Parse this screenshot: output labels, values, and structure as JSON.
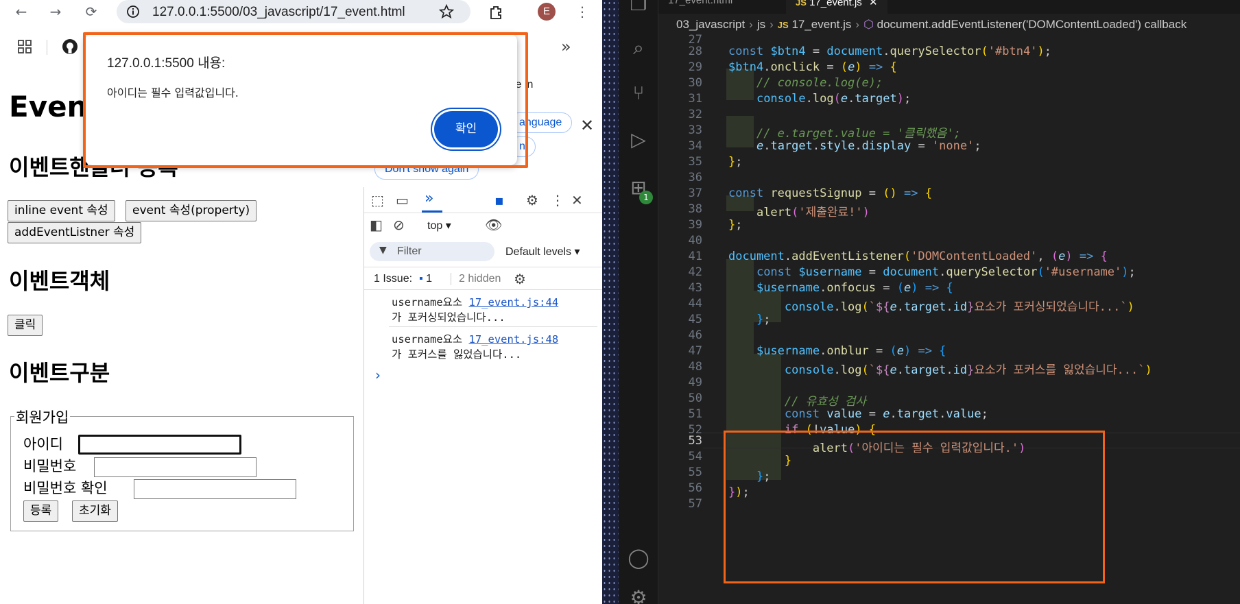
{
  "browser": {
    "url": "127.0.0.1:5500/03_javascript/17_event.html",
    "profile_initial": "E",
    "page": {
      "title_partial": "Even",
      "section1": "이벤트핸들러 등록",
      "buttons": [
        "inline event 속성",
        "event 속성(property)",
        "addEventListner 속성"
      ],
      "section2": "이벤트객체",
      "click_button": "클릭",
      "section3": "이벤트구분",
      "fieldset_legend": "회원가입",
      "id_label": "아이디",
      "pw_label": "비밀번호",
      "pw_confirm_label": "비밀번호 확인",
      "submit_label": "등록",
      "reset_label": "초기화"
    },
    "translate_bubble": {
      "partial_text": "le in",
      "language_button": "anguage",
      "partial_button": "n",
      "dont_show": "Don't show again"
    },
    "devtools": {
      "context": "top",
      "filter_placeholder": "Filter",
      "levels": "Default levels",
      "issues_label": "1 Issue:",
      "issues_count": "1",
      "hidden": "2 hidden",
      "logs": [
        {
          "line1": "username요소 ",
          "link": "17_event.js:44",
          "line2": "가 포커싱되었습니다..."
        },
        {
          "line1": "username요소 ",
          "link": "17_event.js:48",
          "line2": "가 포커스를 잃었습니다..."
        }
      ],
      "prompt": "›"
    },
    "alert": {
      "title": "127.0.0.1:5500 내용:",
      "message": "아이디는 필수 입력값입니다.",
      "ok": "확인"
    }
  },
  "editor": {
    "tabs": [
      "17_event.html",
      "17_event.js"
    ],
    "tab_badge": "JS",
    "breadcrumb": [
      "03_javascript",
      "js",
      "17_event.js",
      "document.addEventListener('DOMContentLoaded') callback"
    ],
    "extensions_badge": "1",
    "partial_top_line": "27",
    "line_numbers": [
      "28",
      "29",
      "30",
      "31",
      "32",
      "33",
      "34",
      "35",
      "36",
      "37",
      "38",
      "39",
      "40",
      "41",
      "42",
      "43",
      "44",
      "45",
      "46",
      "47",
      "48",
      "49",
      "50",
      "51",
      "52",
      "53",
      "54",
      "55",
      "56",
      "57"
    ],
    "current_line": "53"
  },
  "colors": {
    "highlight_border": "#f26419",
    "alert_button": "#0b57d0",
    "editor_bg": "#1f1f1f"
  }
}
